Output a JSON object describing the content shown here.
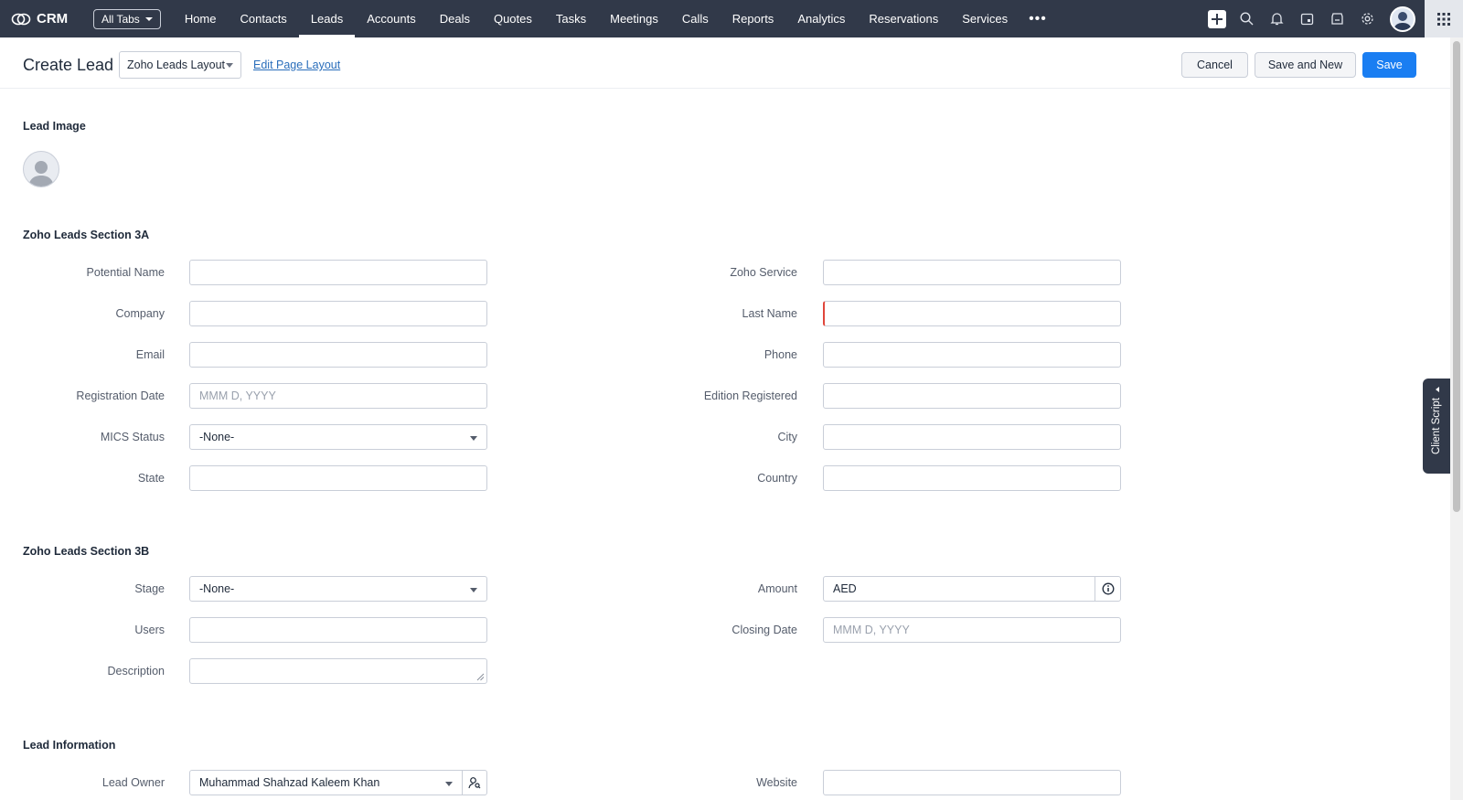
{
  "app": {
    "name": "CRM",
    "all_tabs_label": "All Tabs"
  },
  "nav": {
    "items": [
      {
        "label": "Home",
        "active": false
      },
      {
        "label": "Contacts",
        "active": false
      },
      {
        "label": "Leads",
        "active": true
      },
      {
        "label": "Accounts",
        "active": false
      },
      {
        "label": "Deals",
        "active": false
      },
      {
        "label": "Quotes",
        "active": false
      },
      {
        "label": "Tasks",
        "active": false
      },
      {
        "label": "Meetings",
        "active": false
      },
      {
        "label": "Calls",
        "active": false
      },
      {
        "label": "Reports",
        "active": false
      },
      {
        "label": "Analytics",
        "active": false
      },
      {
        "label": "Reservations",
        "active": false
      },
      {
        "label": "Services",
        "active": false
      }
    ],
    "more_label": "•••",
    "icons": [
      "plus-icon",
      "search-icon",
      "bell-icon",
      "calendar-icon",
      "marketplace-icon",
      "gear-icon",
      "avatar",
      "apps-grid-icon"
    ]
  },
  "header": {
    "title": "Create Lead",
    "layout_select": "Zoho Leads Layout",
    "edit_layout": "Edit Page Layout",
    "cancel": "Cancel",
    "save_and_new": "Save and New",
    "save": "Save"
  },
  "client_script": "Client Script",
  "lead_image": {
    "title": "Lead Image"
  },
  "section_3a": {
    "title": "Zoho Leads Section 3A",
    "left": [
      {
        "label": "Potential Name",
        "value": "",
        "placeholder": ""
      },
      {
        "label": "Company",
        "value": "",
        "placeholder": ""
      },
      {
        "label": "Email",
        "value": "",
        "placeholder": ""
      },
      {
        "label": "Registration Date",
        "value": "",
        "placeholder": "MMM D, YYYY"
      },
      {
        "label": "MICS Status",
        "value": "-None-",
        "placeholder": ""
      },
      {
        "label": "State",
        "value": "",
        "placeholder": ""
      }
    ],
    "right": [
      {
        "label": "Zoho Service",
        "value": "",
        "placeholder": ""
      },
      {
        "label": "Last Name",
        "value": "",
        "placeholder": ""
      },
      {
        "label": "Phone",
        "value": "",
        "placeholder": ""
      },
      {
        "label": "Edition Registered",
        "value": "",
        "placeholder": ""
      },
      {
        "label": "City",
        "value": "",
        "placeholder": ""
      },
      {
        "label": "Country",
        "value": "",
        "placeholder": ""
      }
    ]
  },
  "section_3b": {
    "title": "Zoho Leads Section 3B",
    "left": [
      {
        "label": "Stage",
        "value": "-None-"
      },
      {
        "label": "Users",
        "value": ""
      },
      {
        "label": "Description",
        "value": ""
      }
    ],
    "right": [
      {
        "label": "Amount",
        "value": "AED"
      },
      {
        "label": "Closing Date",
        "placeholder": "MMM D, YYYY"
      }
    ]
  },
  "lead_information": {
    "title": "Lead Information",
    "lead_owner_label": "Lead Owner",
    "lead_owner_value": "Muhammad Shahzad Kaleem Khan",
    "website_label": "Website",
    "website_value": ""
  },
  "colors": {
    "topbar": "#313949",
    "primary": "#1a7ef2",
    "required": "#e0463b"
  }
}
